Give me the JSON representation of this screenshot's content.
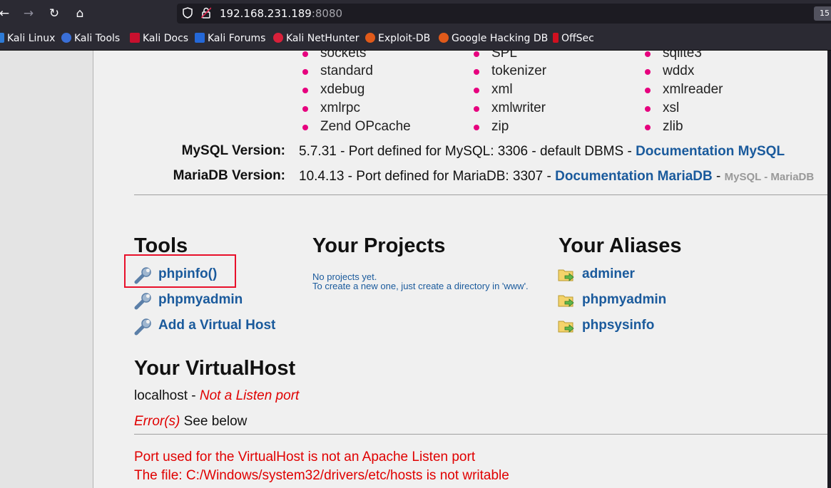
{
  "browser": {
    "url_host": "192.168.231.189",
    "url_port": ":8080",
    "zoom_label": "15",
    "bookmarks": [
      "Kali Linux",
      "Kali Tools",
      "Kali Docs",
      "Kali Forums",
      "Kali NetHunter",
      "Exploit-DB",
      "Google Hacking DB",
      "OffSec"
    ]
  },
  "extensions": {
    "col1": [
      "sockets",
      "standard",
      "xdebug",
      "xmlrpc",
      "Zend OPcache"
    ],
    "col2": [
      "SPL",
      "tokenizer",
      "xml",
      "xmlwriter",
      "zip"
    ],
    "col3": [
      "sqlite3",
      "wddx",
      "xmlreader",
      "xsl",
      "zlib"
    ]
  },
  "mysql": {
    "label": "MySQL Version:",
    "text": "5.7.31 - Port defined for MySQL: 3306 - default DBMS - ",
    "link": "Documentation MySQL"
  },
  "mariadb": {
    "label": "MariaDB Version:",
    "text": "10.4.13 - Port defined for MariaDB: 3307 - ",
    "link": "Documentation MariaDB",
    "sep": " - ",
    "extra": "MySQL - MariaDB"
  },
  "tools": {
    "heading": "Tools",
    "items": [
      "phpinfo()",
      "phpmyadmin",
      "Add a Virtual Host"
    ]
  },
  "projects": {
    "heading": "Your Projects",
    "line1": "No projects yet.",
    "line2": "To create a new one, just create a directory in 'www'."
  },
  "aliases": {
    "heading": "Your Aliases",
    "items": [
      "adminer",
      "phpmyadmin",
      "phpsysinfo"
    ]
  },
  "vhost": {
    "heading": "Your VirtualHost",
    "host": "localhost",
    "dash": " - ",
    "status": "Not a Listen port",
    "errors_label": "Error(s)",
    "errors_text": " See below",
    "error1": "Port used for the VirtualHost is not an Apache Listen port",
    "error2": "The file: C:/Windows/system32/drivers/etc/hosts is not writable"
  },
  "colors": {
    "bullet": "#e6007e",
    "link": "#1a5a9c",
    "error": "#e00000",
    "highlight": "#e8102a"
  }
}
